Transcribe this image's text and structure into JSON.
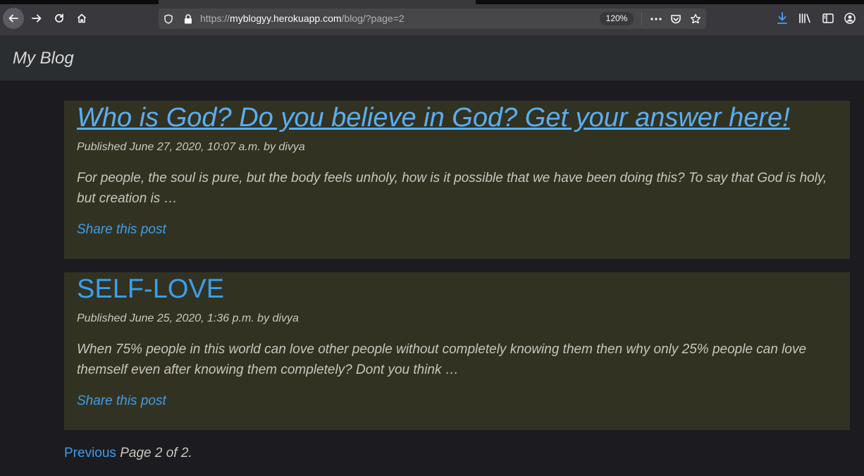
{
  "browser": {
    "url_prefix": "https://",
    "url_host": "myblogyy.herokuapp.com",
    "url_path": "/blog/?page=2",
    "zoom": "120%"
  },
  "site": {
    "title": "My Blog"
  },
  "posts": [
    {
      "title": "Who is God? Do you believe in God? Get your answer here!",
      "meta": "Published June 27, 2020, 10:07 a.m. by divya",
      "excerpt": "For people, the soul is pure, but the body feels unholy, how is it possible that we have been doing this? To say that God is holy, but creation is …",
      "share_label": "Share this post"
    },
    {
      "title": "SELF-LOVE",
      "meta": "Published June 25, 2020, 1:36 p.m. by divya",
      "excerpt": "When 75% people in this world can love other people without completely knowing them then why only 25% people can love themself even after knowing them completely? Dont you think …",
      "share_label": "Share this post"
    }
  ],
  "pagination": {
    "previous_label": "Previous",
    "page_info": " Page 2 of 2."
  },
  "colors": {
    "link": "#3d9ee8",
    "post_background": "#323223",
    "header_background": "#2b2e31"
  }
}
